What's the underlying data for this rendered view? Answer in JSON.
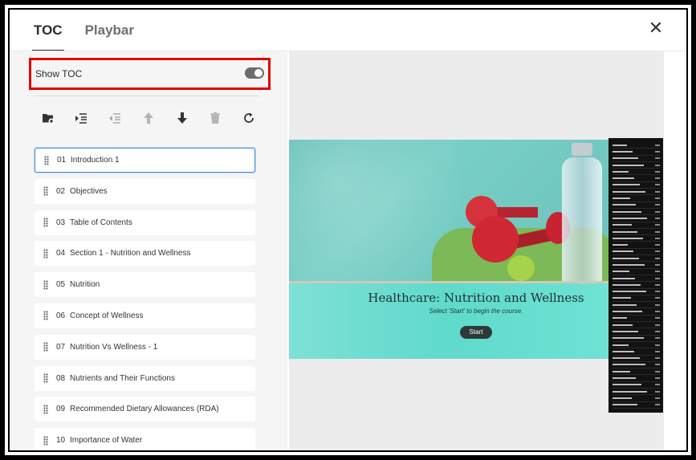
{
  "tabs": [
    {
      "label": "TOC",
      "active": true
    },
    {
      "label": "Playbar",
      "active": false
    }
  ],
  "close_icon": "close-icon",
  "show_toc": {
    "label": "Show TOC",
    "enabled": true
  },
  "toolbar": {
    "icons": [
      "add-folder-icon",
      "indent-icon",
      "outdent-icon",
      "move-up-icon",
      "move-down-icon",
      "trash-icon",
      "reset-icon"
    ]
  },
  "toc_items": [
    {
      "num": "01",
      "label": "Introduction 1"
    },
    {
      "num": "02",
      "label": "Objectives"
    },
    {
      "num": "03",
      "label": "Table of Contents"
    },
    {
      "num": "04",
      "label": "Section 1 - Nutrition and Wellness"
    },
    {
      "num": "05",
      "label": "Nutrition"
    },
    {
      "num": "06",
      "label": "Concept of Wellness"
    },
    {
      "num": "07",
      "label": "Nutrition Vs Wellness - 1"
    },
    {
      "num": "08",
      "label": "Nutrients and Their Functions"
    },
    {
      "num": "09",
      "label": "Recommended Dietary Allowances (RDA)"
    },
    {
      "num": "10",
      "label": "Importance of Water"
    }
  ],
  "preview": {
    "title": "Healthcare: Nutrition and Wellness",
    "subtitle": "Select 'Start' to begin the course.",
    "start_label": "Start"
  },
  "colors": {
    "highlight_border": "#e10000",
    "selected_border": "#4a8cdc",
    "accent_teal": "#5fdacb"
  }
}
